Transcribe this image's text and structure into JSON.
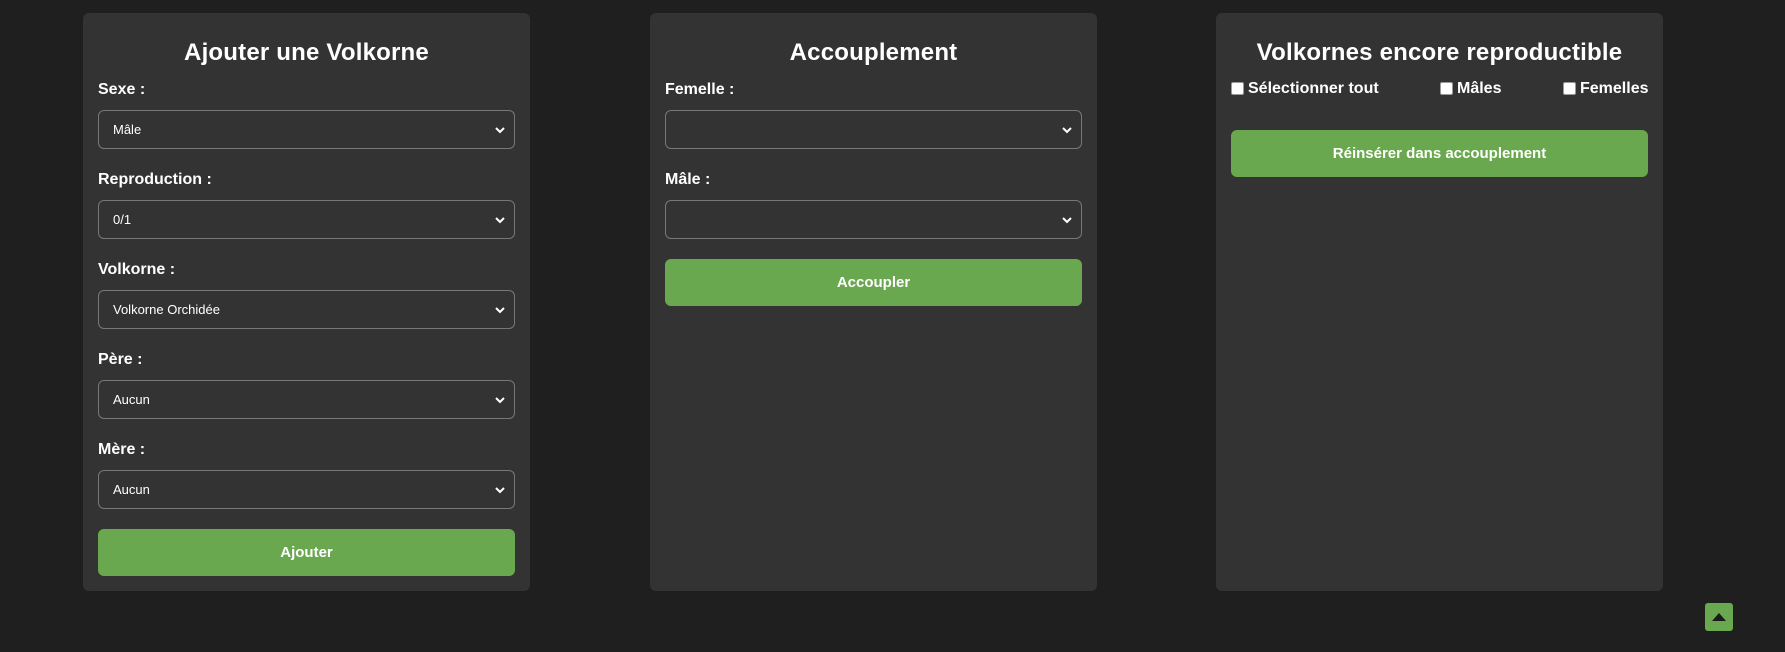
{
  "add_panel": {
    "title": "Ajouter une Volkorne",
    "sexe_label": "Sexe :",
    "sexe_value": "Mâle",
    "reproduction_label": "Reproduction :",
    "reproduction_value": "0/1",
    "volkorne_label": "Volkorne :",
    "volkorne_value": "Volkorne Orchidée",
    "pere_label": "Père :",
    "pere_value": "Aucun",
    "mere_label": "Mère :",
    "mere_value": "Aucun",
    "button_label": "Ajouter"
  },
  "mating_panel": {
    "title": "Accouplement",
    "femelle_label": "Femelle :",
    "femelle_value": "",
    "male_label": "Mâle :",
    "male_value": "",
    "button_label": "Accoupler"
  },
  "repro_panel": {
    "title": "Volkornes encore reproductible",
    "select_all_label": "Sélectionner tout",
    "males_label": "Mâles",
    "femelles_label": "Femelles",
    "button_label": "Réinsérer dans accouplement"
  },
  "colors": {
    "background": "#1f1f1f",
    "panel": "#333333",
    "accent": "#6aa84f"
  },
  "icons": {
    "select_chevron": "chevron-down-icon",
    "scroll_top": "caret-up-icon"
  }
}
